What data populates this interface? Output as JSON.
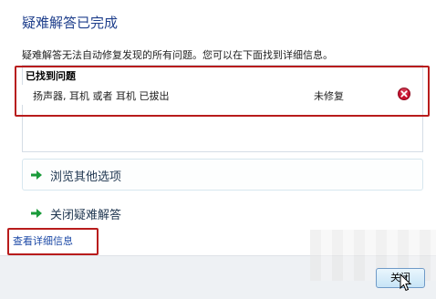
{
  "header": {
    "title": "疑难解答已完成"
  },
  "description": "疑难解答无法自动修复发现的所有问题。您可以在下面找到详细信息。",
  "problems": {
    "header": "已找到问题",
    "items": [
      {
        "name": "扬声器, 耳机 或者 耳机 已拔出",
        "status": "未修复",
        "status_icon": "error-x-icon"
      }
    ]
  },
  "options": {
    "browse_label": "浏览其他选项",
    "close_label": "关闭疑难解答"
  },
  "links": {
    "details": "查看详细信息"
  },
  "footer": {
    "close_button": "关闭"
  },
  "colors": {
    "title": "#1f3f8c",
    "link": "#1c49a6",
    "highlight_outline": "#b81c1c",
    "arrow": "#1a9b3a",
    "error": "#c8102e"
  }
}
